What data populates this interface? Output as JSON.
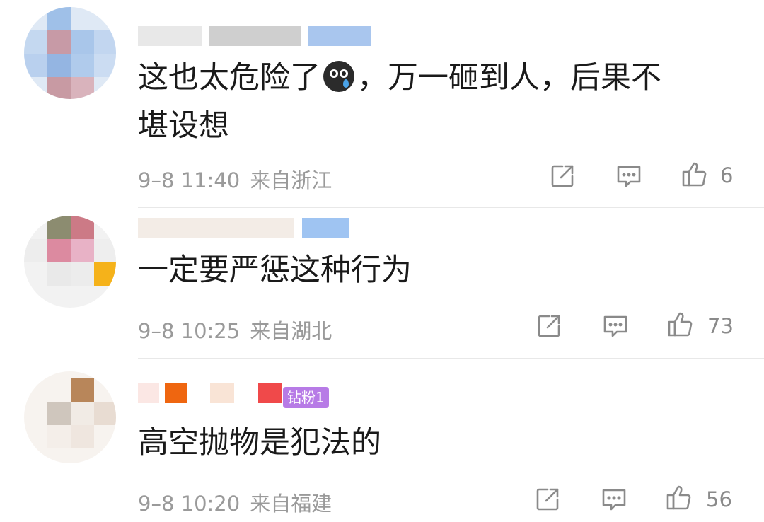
{
  "comments": [
    {
      "text_line1": "这也太危险了",
      "text_line1_after_emoji": "，万一砸到人，后果不",
      "text_line2": "堪设想",
      "emoji": "crying-face-emoji",
      "time": "9–8 11:40",
      "location": "来自浙江",
      "likes": "6"
    },
    {
      "text_line1": "一定要严惩这种行为",
      "time": "9–8 10:25",
      "location": "来自湖北",
      "likes": "73"
    },
    {
      "text_line1": "高空抛物是犯法的",
      "badge": "钻粉1",
      "time": "9–8 10:20",
      "location": "来自福建",
      "likes": "56"
    }
  ],
  "icons": {
    "share": "share-icon",
    "reply": "comment-icon",
    "like": "thumbs-up-icon"
  },
  "colors": {
    "text": "#1a1a1a",
    "meta": "#9a9a9a",
    "badge": "#b77be6",
    "icon": "#8a8a8a"
  }
}
